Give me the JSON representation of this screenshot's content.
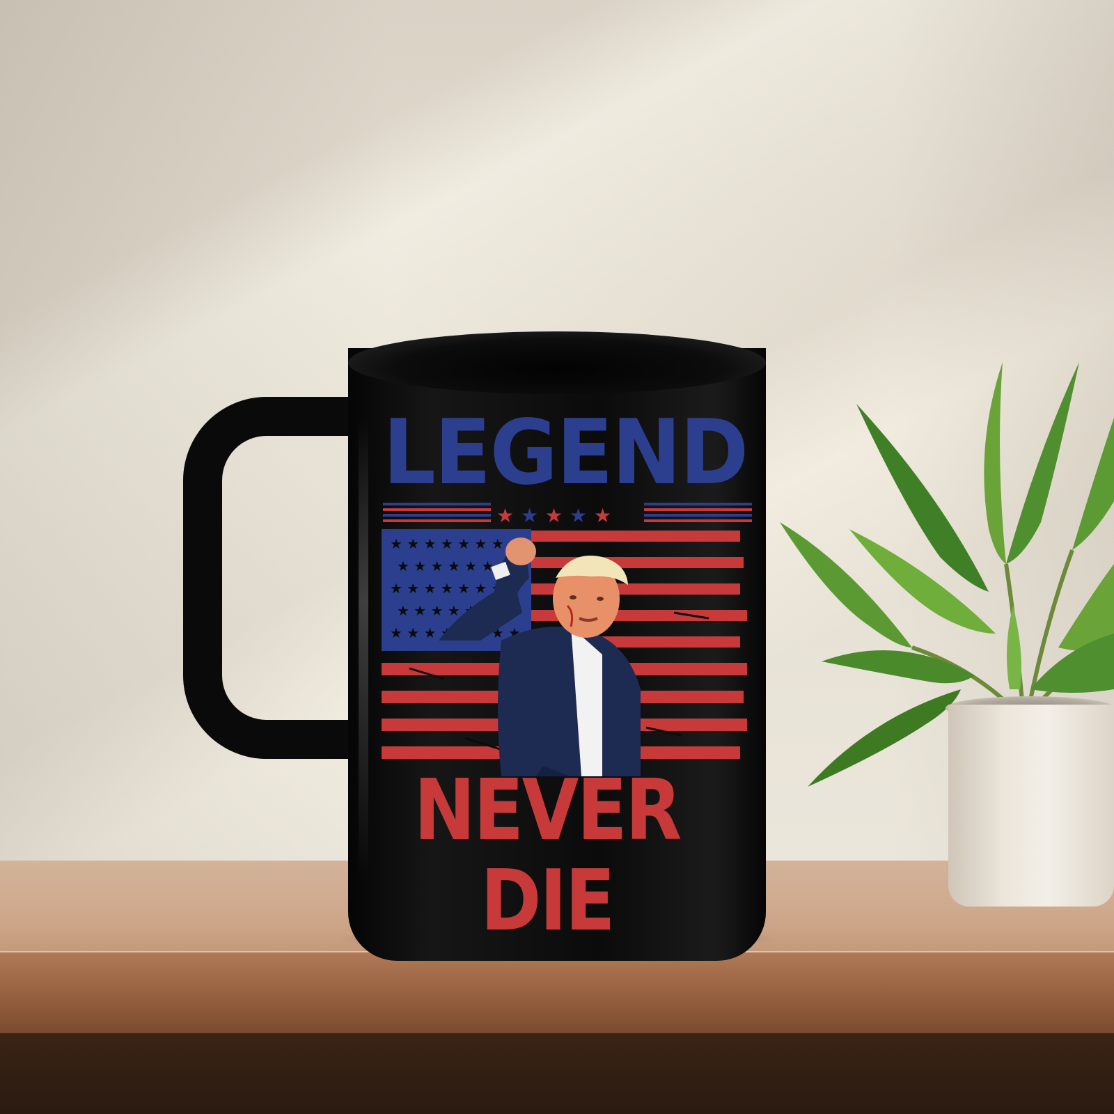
{
  "mug": {
    "line1": "LEGEND",
    "line2": "NEVER DIE",
    "colors": {
      "mug_black": "#0b0b0b",
      "blue": "#2c3f8e",
      "red": "#c83a3a"
    }
  },
  "scene": {
    "colors": {
      "wall": "#e6e0d3",
      "shelf": "#cfa88b",
      "plant_leaf": "#4f8f2f",
      "pot": "#ece6dc"
    }
  },
  "icons": [
    "star-icon",
    "american-flag-graphic",
    "plant-graphic"
  ]
}
